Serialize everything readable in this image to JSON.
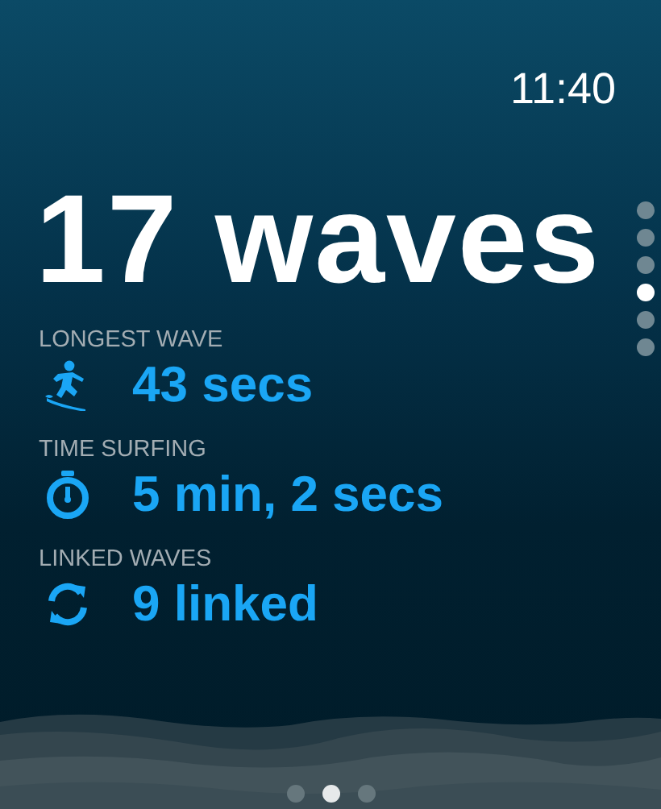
{
  "status_bar": {
    "time": "11:40"
  },
  "headline": "17 waves",
  "stats": [
    {
      "label": "LONGEST WAVE",
      "value": "43 secs",
      "kind": "surfer"
    },
    {
      "label": "TIME SURFING",
      "value": "5 min, 2 secs",
      "kind": "stopwatch"
    },
    {
      "label": "LINKED WAVES",
      "value": "9 linked",
      "kind": "linked"
    }
  ],
  "side_pages": [
    {
      "selected": false
    },
    {
      "selected": false
    },
    {
      "selected": false
    },
    {
      "selected": true
    },
    {
      "selected": false
    },
    {
      "selected": false
    }
  ],
  "bottom_pages": [
    {
      "selected": false
    },
    {
      "selected": true
    },
    {
      "selected": false
    }
  ]
}
